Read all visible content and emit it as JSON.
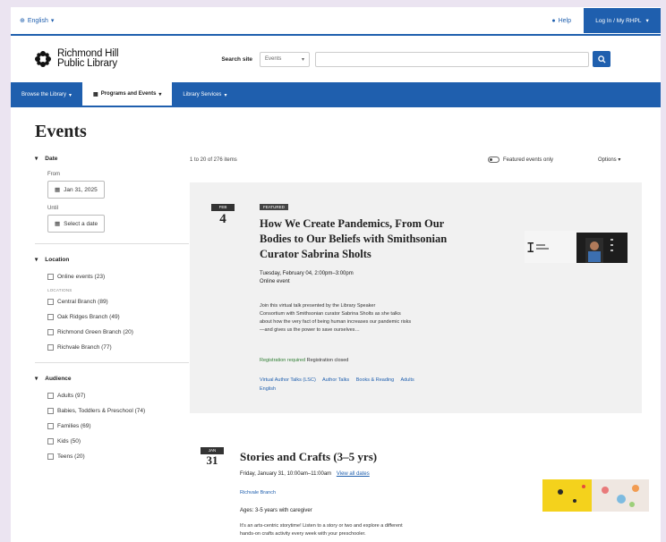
{
  "utility": {
    "language": "English",
    "help": "Help",
    "login": "Log In / My RHPL"
  },
  "header": {
    "logo_line1": "Richmond Hill",
    "logo_line2": "Public Library",
    "search_label": "Search site",
    "scope_value": "Events"
  },
  "nav": {
    "items": [
      {
        "label": "Browse the Library"
      },
      {
        "label": "Programs and Events"
      },
      {
        "label": "Library Services"
      }
    ]
  },
  "page_title": "Events",
  "sidebar": {
    "date": {
      "heading": "Date",
      "from_label": "From",
      "from_value": "Jan 31, 2025",
      "until_label": "Until",
      "until_value": "Select a date"
    },
    "location": {
      "heading": "Location",
      "online": "Online events (23)",
      "sublabel": "LOCATIONS",
      "items": [
        "Central Branch (89)",
        "Oak Ridges Branch (49)",
        "Richmond Green Branch (20)",
        "Richvale Branch (77)"
      ]
    },
    "audience": {
      "heading": "Audience",
      "items": [
        "Adults (97)",
        "Babies, Toddlers & Preschool (74)",
        "Families (69)",
        "Kids (50)",
        "Teens (20)"
      ]
    }
  },
  "results": {
    "count_text": "1 to 20 of 276 items",
    "featured_label": "Featured events only",
    "options_label": "Options"
  },
  "event1": {
    "month": "FEB",
    "day": "4",
    "tag": "FEATURED",
    "title_line1": "How We Create Pandemics, From Our",
    "title_line2": "Bodies to Our Beliefs with Smithsonian",
    "title_line3": "Curator Sabrina Sholts",
    "time": "Tuesday, February 04, 2:00pm–3:00pm",
    "location": "Online event",
    "desc_line1": "Join this virtual talk presented by the Library Speaker",
    "desc_line2": "Consortium with Smithsonian curator Sabrina Sholts as she talks",
    "desc_line3": "about how the very fact of being human increases our pandemic risks",
    "desc_line4": "—and gives us the power to save ourselves…",
    "reg_status": "Registration required",
    "reg_note": "Registration closed",
    "tags": [
      "Virtual Author Talks (LSC)",
      "Author Talks",
      "Books & Reading",
      "Adults"
    ],
    "language": "English"
  },
  "event2": {
    "month": "JAN",
    "day": "31",
    "title": "Stories and Crafts (3–5 yrs)",
    "time": "Friday, January 31, 10:00am–11:00am",
    "more_dates": "View all dates",
    "location": "Richvale Branch",
    "ages": "Ages: 3-5 years with caregiver",
    "desc_line1": "It's an arts-centric storytime! Listen to a story or two and explore a different",
    "desc_line2": "hands-on crafts activity every week with your preschooler."
  }
}
